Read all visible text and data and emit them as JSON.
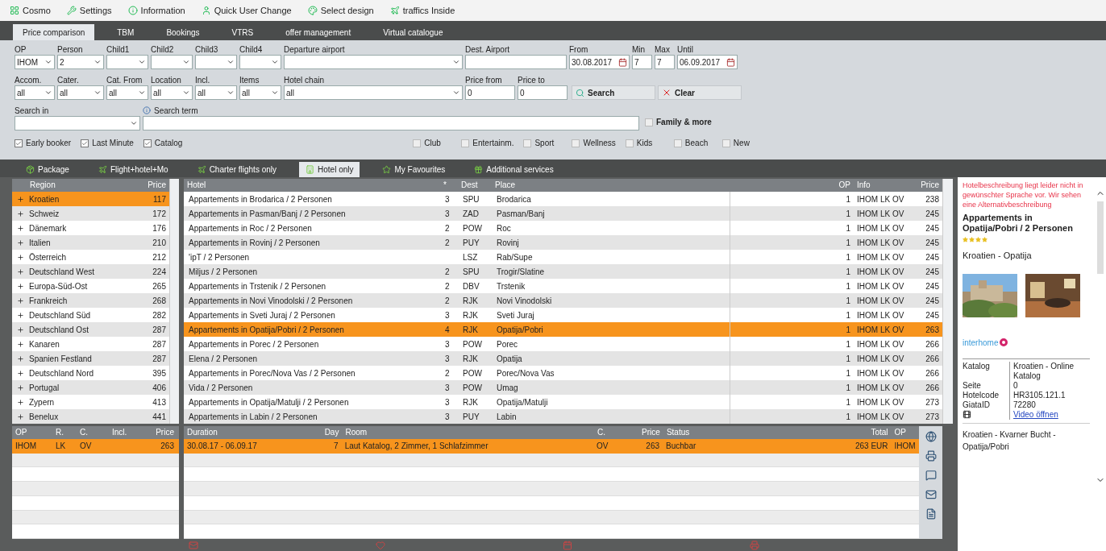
{
  "menu": [
    "Cosmo",
    "Settings",
    "Information",
    "Quick User Change",
    "Select design",
    "traffics Inside"
  ],
  "main_tabs": [
    {
      "label": "Price comparison",
      "selected": true
    },
    {
      "label": "TBM",
      "selected": false
    },
    {
      "label": "Bookings",
      "selected": false
    },
    {
      "label": "VTRS",
      "selected": false
    },
    {
      "label": "offer management",
      "selected": false
    },
    {
      "label": "Virtual catalogue",
      "selected": false
    }
  ],
  "form_row1": [
    {
      "label": "OP",
      "value": "IHOM",
      "kind": "select"
    },
    {
      "label": "Person",
      "value": "2",
      "kind": "select"
    },
    {
      "label": "Child1",
      "kind": "select"
    },
    {
      "label": "Child2",
      "kind": "select"
    },
    {
      "label": "Child3",
      "kind": "select"
    },
    {
      "label": "Child4",
      "kind": "select"
    },
    {
      "label": "Departure airport",
      "kind": "select"
    },
    {
      "label": "Dest. Airport",
      "kind": "text"
    },
    {
      "label": "From",
      "value": "30.08.2017",
      "kind": "date"
    },
    {
      "label": "Min",
      "value": "7",
      "kind": "text"
    },
    {
      "label": "Max",
      "value": "7",
      "kind": "text"
    },
    {
      "label": "Until",
      "value": "06.09.2017",
      "kind": "date"
    }
  ],
  "form_row2": [
    {
      "label": "Accom.",
      "value": "all",
      "kind": "select"
    },
    {
      "label": "Cater.",
      "value": "all",
      "kind": "select"
    },
    {
      "label": "Cat. From",
      "value": "all",
      "kind": "select"
    },
    {
      "label": "Location",
      "value": "all",
      "kind": "select"
    },
    {
      "label": "Incl.",
      "value": "all",
      "kind": "select"
    },
    {
      "label": "Items",
      "value": "all",
      "kind": "select"
    },
    {
      "label": "Hotel chain",
      "value": "all",
      "kind": "select"
    },
    {
      "label": "Price from",
      "value": "0",
      "kind": "text"
    },
    {
      "label": "Price to",
      "value": "0",
      "kind": "text"
    }
  ],
  "search_button": "Search",
  "clear_button": "Clear",
  "search_in": {
    "label": "Search in"
  },
  "search_term": {
    "label": "Search term"
  },
  "family": {
    "label": "Family & more",
    "checked": false
  },
  "filters": [
    {
      "label": "Early booker",
      "checked": true
    },
    {
      "label": "Last Minute",
      "checked": true
    },
    {
      "label": "Catalog",
      "checked": true
    }
  ],
  "themes": [
    {
      "label": "Club",
      "checked": false
    },
    {
      "label": "Entertainm.",
      "checked": false
    },
    {
      "label": "Sport",
      "checked": false
    },
    {
      "label": "Wellness",
      "checked": false
    },
    {
      "label": "Kids",
      "checked": false
    },
    {
      "label": "Beach",
      "checked": false
    },
    {
      "label": "New",
      "checked": false
    }
  ],
  "sub_tabs": [
    {
      "label": "Package",
      "selected": false
    },
    {
      "label": "Flight+hotel+Mo",
      "selected": false
    },
    {
      "label": "Charter flights only",
      "selected": false
    },
    {
      "label": "Hotel only",
      "selected": true
    },
    {
      "label": "My Favourites",
      "selected": false
    },
    {
      "label": "Additional services",
      "selected": false
    }
  ],
  "regions": {
    "columns": [
      "Region",
      "Price"
    ],
    "rows": [
      {
        "name": "Kroatien",
        "price": "117",
        "selected": true
      },
      {
        "name": "Schweiz",
        "price": "172",
        "selected": false
      },
      {
        "name": "Dänemark",
        "price": "176",
        "selected": false
      },
      {
        "name": "Italien",
        "price": "210",
        "selected": false
      },
      {
        "name": "Österreich",
        "price": "212",
        "selected": false
      },
      {
        "name": "Deutschland West",
        "price": "224",
        "selected": false
      },
      {
        "name": "Europa-Süd-Ost",
        "price": "265",
        "selected": false
      },
      {
        "name": "Frankreich",
        "price": "268",
        "selected": false
      },
      {
        "name": "Deutschland Süd",
        "price": "282",
        "selected": false
      },
      {
        "name": "Deutschland Ost",
        "price": "287",
        "selected": false
      },
      {
        "name": "Kanaren",
        "price": "287",
        "selected": false
      },
      {
        "name": "Spanien Festland",
        "price": "287",
        "selected": false
      },
      {
        "name": "Deutschland Nord",
        "price": "395",
        "selected": false
      },
      {
        "name": "Portugal",
        "price": "406",
        "selected": false
      },
      {
        "name": "Zypern",
        "price": "413",
        "selected": false
      },
      {
        "name": "Benelux",
        "price": "441",
        "selected": false
      }
    ]
  },
  "hotels": {
    "columns": [
      "Hotel",
      "*",
      "Dest",
      "Place",
      "OP",
      "Info",
      "Price"
    ],
    "rows": [
      {
        "cells": [
          "Appartements in Brodarica / 2 Personen",
          "3",
          "SPU",
          "Brodarica",
          "1",
          "IHOM LK OV",
          "238"
        ],
        "selected": false
      },
      {
        "cells": [
          "Appartements in Pasman/Banj / 2 Personen",
          "3",
          "ZAD",
          "Pasman/Banj",
          "1",
          "IHOM LK OV",
          "245"
        ],
        "selected": false
      },
      {
        "cells": [
          "Appartements in Roc / 2 Personen",
          "2",
          "POW",
          "Roc",
          "1",
          "IHOM LK OV",
          "245"
        ],
        "selected": false
      },
      {
        "cells": [
          "Appartements in Rovinj / 2 Personen",
          "2",
          "PUY",
          "Rovinj",
          "1",
          "IHOM LK OV",
          "245"
        ],
        "selected": false
      },
      {
        "cells": [
          "'ipT / 2 Personen",
          null,
          "LSZ",
          "Rab/Supe",
          "1",
          "IHOM LK OV",
          "245"
        ],
        "selected": false
      },
      {
        "cells": [
          "Miljus / 2 Personen",
          "2",
          "SPU",
          "Trogir/Slatine",
          "1",
          "IHOM LK OV",
          "245"
        ],
        "selected": false
      },
      {
        "cells": [
          "Appartements in Trstenik / 2 Personen",
          "2",
          "DBV",
          "Trstenik",
          "1",
          "IHOM LK OV",
          "245"
        ],
        "selected": false
      },
      {
        "cells": [
          "Appartements in Novi Vinodolski / 2 Personen",
          "2",
          "RJK",
          "Novi Vinodolski",
          "1",
          "IHOM LK OV",
          "245"
        ],
        "selected": false
      },
      {
        "cells": [
          "Appartements in Sveti Juraj / 2 Personen",
          "3",
          "RJK",
          "Sveti Juraj",
          "1",
          "IHOM LK OV",
          "245"
        ],
        "selected": false
      },
      {
        "cells": [
          "Appartements in Opatija/Pobri / 2 Personen",
          "4",
          "RJK",
          "Opatija/Pobri",
          "1",
          "IHOM LK OV",
          "263"
        ],
        "selected": true
      },
      {
        "cells": [
          "Appartements in Porec / 2 Personen",
          "3",
          "POW",
          "Porec",
          "1",
          "IHOM LK OV",
          "266"
        ],
        "selected": false
      },
      {
        "cells": [
          "Elena / 2 Personen",
          "3",
          "RJK",
          "Opatija",
          "1",
          "IHOM LK OV",
          "266"
        ],
        "selected": false
      },
      {
        "cells": [
          "Appartements in Porec/Nova Vas / 2 Personen",
          "2",
          "POW",
          "Porec/Nova Vas",
          "1",
          "IHOM LK OV",
          "266"
        ],
        "selected": false
      },
      {
        "cells": [
          "Vida / 2 Personen",
          "3",
          "POW",
          "Umag",
          "1",
          "IHOM LK OV",
          "266"
        ],
        "selected": false
      },
      {
        "cells": [
          "Appartements in Opatija/Matulji / 2 Personen",
          "3",
          "RJK",
          "Opatija/Matulji",
          "1",
          "IHOM LK OV",
          "273"
        ],
        "selected": false
      },
      {
        "cells": [
          "Appartements in Labin / 2 Personen",
          "3",
          "PUY",
          "Labin",
          "1",
          "IHOM LK OV",
          "273"
        ],
        "selected": false
      }
    ]
  },
  "offers": {
    "columns": [
      "OP",
      "R.",
      "C.",
      "Incl.",
      "Price"
    ],
    "rows": [
      {
        "cells": [
          "IHOM",
          "LK",
          "OV",
          null,
          "263"
        ],
        "selected": true
      }
    ]
  },
  "details": {
    "columns": [
      "Duration",
      "Day",
      "Room",
      "C.",
      "Price",
      "Status",
      "Total",
      "OP"
    ],
    "rows": [
      {
        "cells": [
          "30.08.17 - 06.09.17",
          "7",
          "Laut Katalog, 2 Zimmer, 1 Schlafzimmer",
          "OV",
          "263",
          "Buchbar",
          "263 EUR",
          "IHOM"
        ],
        "selected": true
      }
    ]
  },
  "info": {
    "notice": "Hotelbeschreibung liegt leider nicht in gewünschter Sprache vor. Wir sehen eine Alternativbeschreibung",
    "title": "Appartements in Opatija/Pobri / 2 Personen",
    "stars": 4,
    "location": "Kroatien - Opatija",
    "brand": "interhome",
    "facts": [
      {
        "key": "Katalog",
        "value": "Kroatien - Online Katalog"
      },
      {
        "key": "Seite",
        "value": "0"
      },
      {
        "key": "Hotelcode",
        "value": "HR3105.121.1"
      },
      {
        "key": "GiataID",
        "value": "72280"
      }
    ],
    "video_link": "Video öffnen",
    "region": "Kroatien - Kvarner Bucht - Opatija/Pobri"
  }
}
